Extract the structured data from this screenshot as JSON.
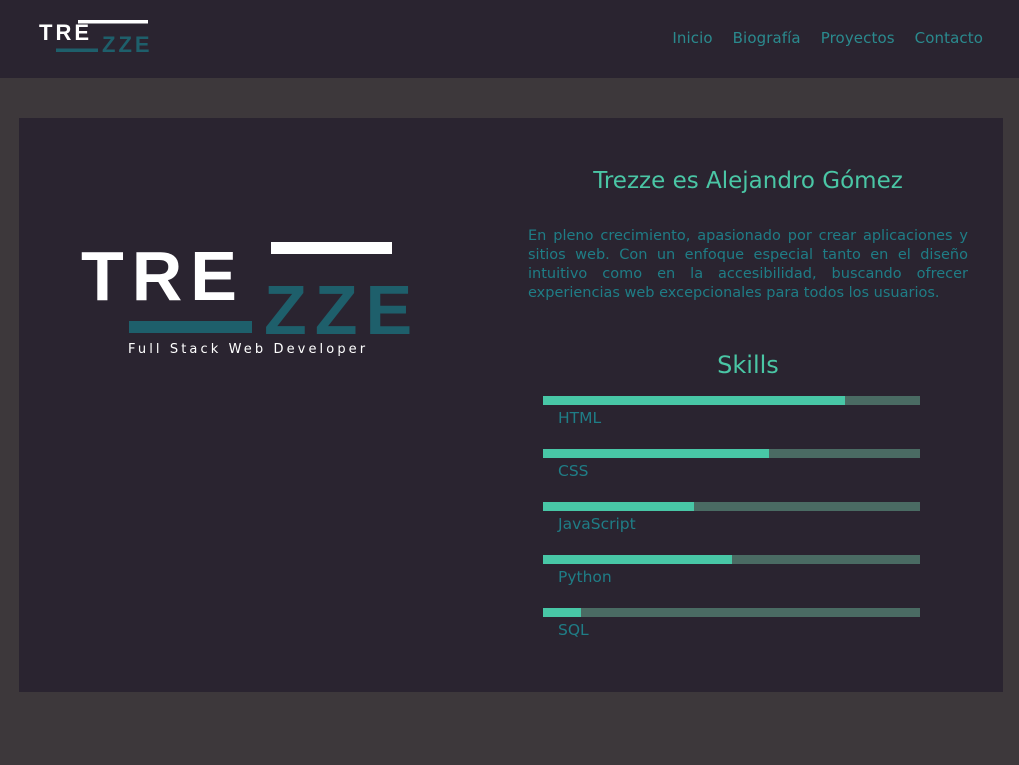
{
  "header": {
    "logo": {
      "top": "TRE",
      "bottom": "ZZE"
    },
    "nav": [
      {
        "label": "Inicio"
      },
      {
        "label": "Biografía"
      },
      {
        "label": "Proyectos"
      },
      {
        "label": "Contacto"
      }
    ]
  },
  "hero": {
    "logo": {
      "top": "TRE",
      "bottom": "ZZE"
    },
    "tagline": "Full Stack Web Developer"
  },
  "bio": {
    "title": "Trezze es Alejandro Gómez",
    "text": "En pleno crecimiento, apasionado por crear aplicaciones y sitios web. Con un enfoque especial tanto en el diseño intuitivo como en la accesibilidad, buscando ofrecer experiencias web excepcionales para todos los usuarios."
  },
  "skills": {
    "title": "Skills",
    "items": [
      {
        "name": "HTML",
        "level": 0.8
      },
      {
        "name": "CSS",
        "level": 0.6
      },
      {
        "name": "JavaScript",
        "level": 0.4
      },
      {
        "name": "Python",
        "level": 0.5
      },
      {
        "name": "SQL",
        "level": 0.1
      }
    ]
  },
  "colors": {
    "background": "#3d383b",
    "panel": "#2a2430",
    "accent": "#48c7a6",
    "teal_text": "#1f7d86",
    "bar_track": "#4a6b63",
    "logo_dark_teal": "#1e5f6b",
    "white": "#ffffff"
  }
}
